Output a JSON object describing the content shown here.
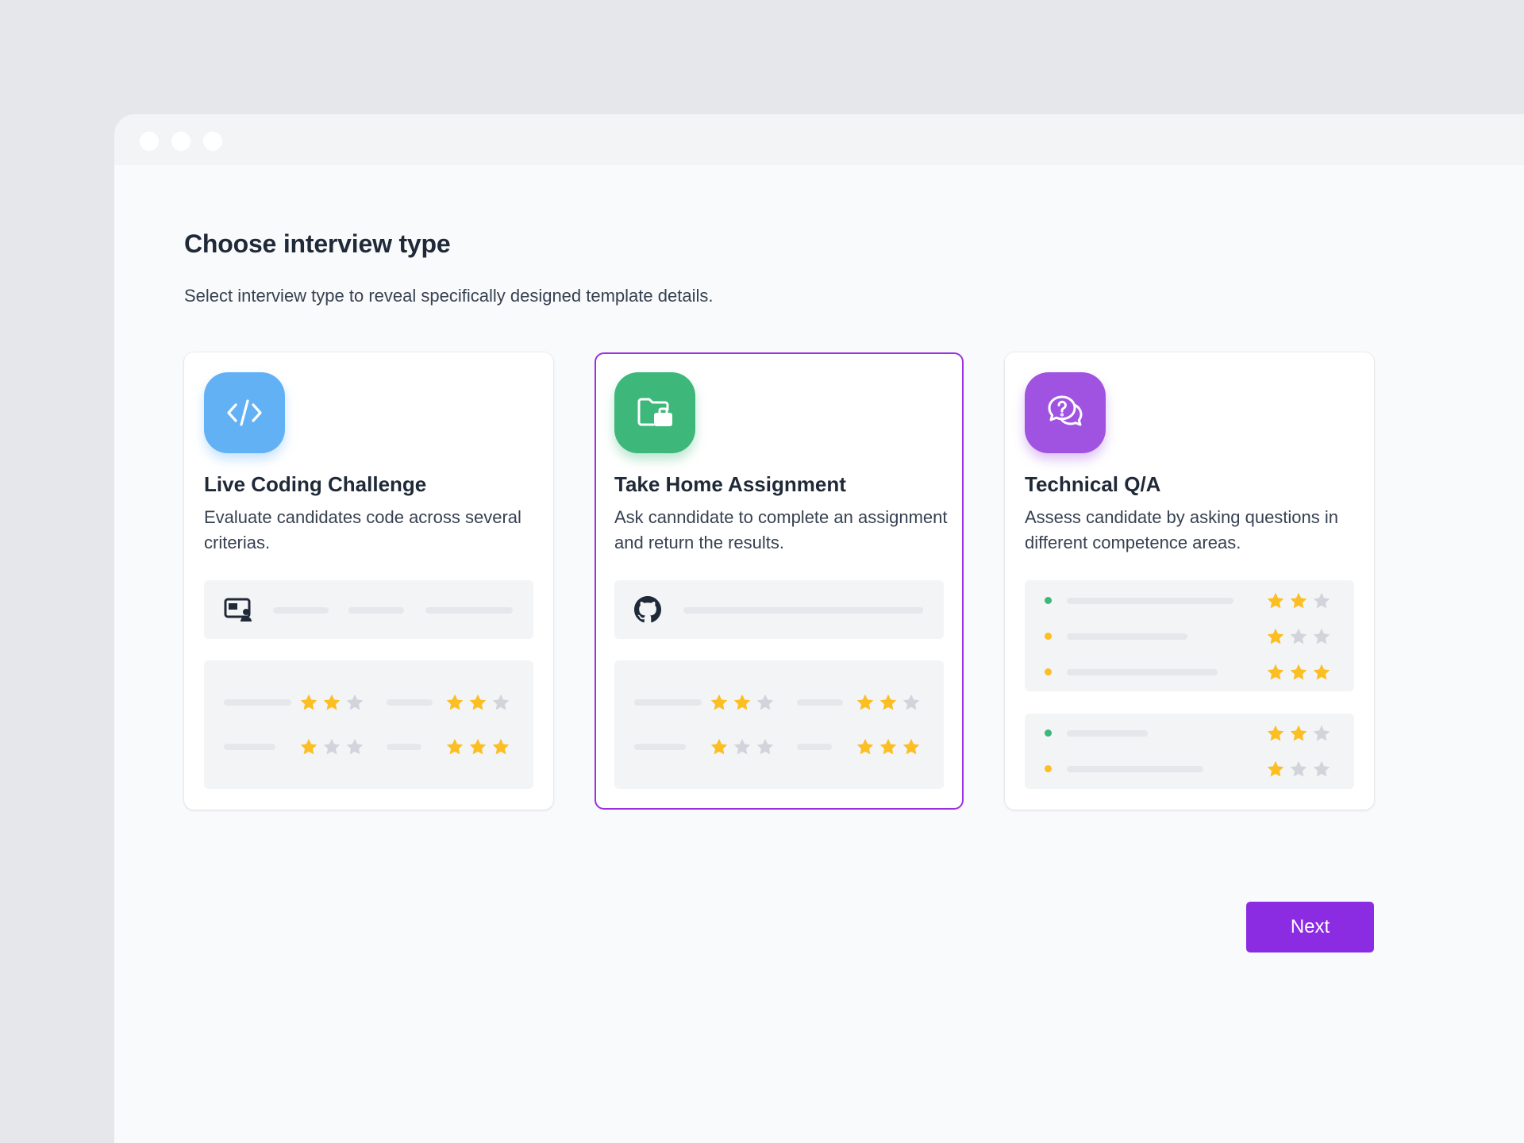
{
  "page": {
    "title": "Choose interview type",
    "subtitle": "Select interview type to reveal specifically designed template details."
  },
  "cards": [
    {
      "icon": "code-icon",
      "color": "#63b1f5",
      "title": "Live Coding Challenge",
      "description": "Evaluate candidates code across several criterias.",
      "selected": false,
      "tool_icon": "screen-share-icon",
      "ratings": [
        [
          2,
          2
        ],
        [
          1,
          3
        ]
      ]
    },
    {
      "icon": "folder-briefcase-icon",
      "color": "#3eb77a",
      "title": "Take Home Assignment",
      "description": "Ask canndidate to complete an assignment and return the results.",
      "selected": true,
      "tool_icon": "github-icon",
      "ratings": [
        [
          2,
          2
        ],
        [
          1,
          3
        ]
      ]
    },
    {
      "icon": "chat-question-icon",
      "color": "#a053e0",
      "title": "Technical Q/A",
      "description": "Assess candidate by asking questions in different competence areas.",
      "selected": false,
      "ratings": [
        2,
        1,
        3,
        2,
        1
      ]
    }
  ],
  "actions": {
    "next_label": "Next"
  },
  "colors": {
    "accent": "#8b2be2",
    "star_on": "#fbbf24",
    "star_off": "#d1d5db"
  }
}
